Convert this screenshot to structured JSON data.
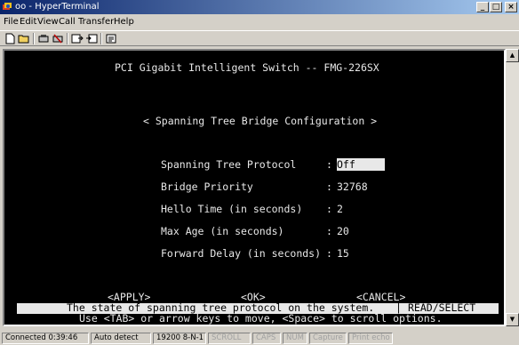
{
  "window": {
    "title": "oo - HyperTerminal",
    "minimize_icon": "minimize-icon",
    "maximize_icon": "maximize-icon",
    "close_icon": "close-icon"
  },
  "menu": {
    "items": [
      {
        "label": "File"
      },
      {
        "label": "Edit"
      },
      {
        "label": "View"
      },
      {
        "label": "Call"
      },
      {
        "label": "Transfer"
      },
      {
        "label": "Help"
      }
    ]
  },
  "toolbar": {
    "icons": [
      "new-icon",
      "open-icon",
      "connect-icon",
      "disconnect-icon",
      "send-icon",
      "receive-icon",
      "properties-icon"
    ]
  },
  "terminal": {
    "header": "PCI Gigabit Intelligent Switch -- FMG-226SX",
    "section_title": "< Spanning Tree Bridge Configuration >",
    "fields": [
      {
        "label": "Spanning Tree Protocol",
        "value": "Off"
      },
      {
        "label": "Bridge Priority",
        "value": "32768"
      },
      {
        "label": "Hello Time (in seconds)",
        "value": "2"
      },
      {
        "label": "Max Age (in seconds)",
        "value": "20"
      },
      {
        "label": "Forward Delay (in seconds)",
        "value": "15"
      }
    ],
    "actions": {
      "apply": "<APPLY>",
      "ok": "<OK>",
      "cancel": "<CANCEL>"
    },
    "status_message": "The state of spanning tree protocol on the system.",
    "status_mode": "READ/SELECT",
    "help_line": "Use <TAB> or arrow keys to move, <Space> to scroll options."
  },
  "statusbar": {
    "connected": "Connected 0:39:46",
    "detect": "Auto detect",
    "port": "19200 8-N-1",
    "scroll": "SCROLL",
    "caps": "CAPS",
    "num": "NUM",
    "capture": "Capture",
    "print_echo": "Print echo"
  }
}
